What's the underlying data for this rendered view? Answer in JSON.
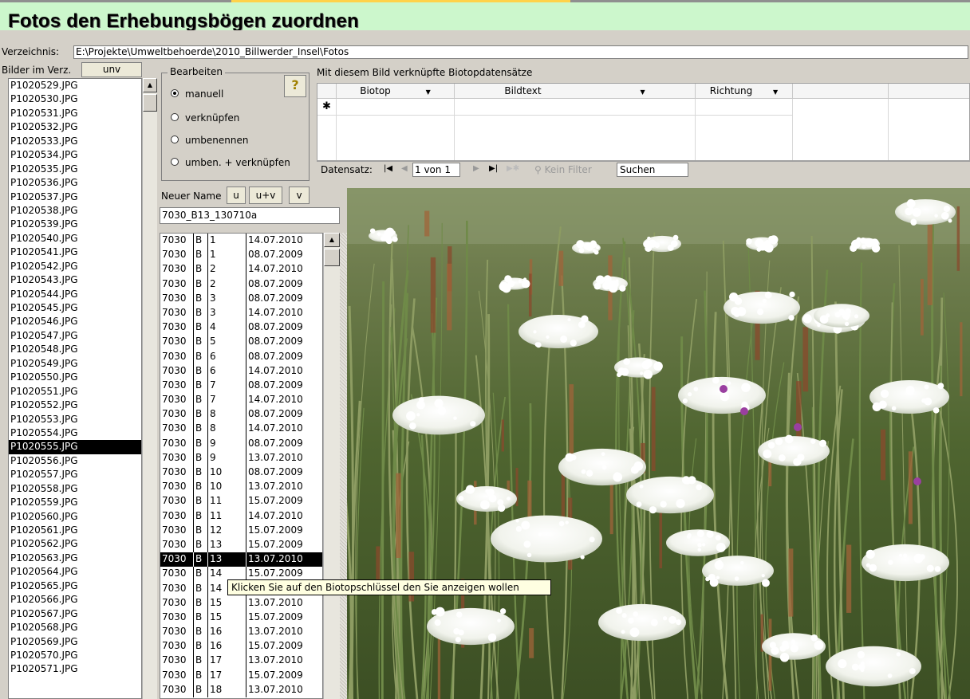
{
  "title": "Fotos den Erhebungsbögen zuordnen",
  "directory": {
    "label": "Verzeichnis:",
    "value": "E:\\Projekte\\Umweltbehoerde\\2010_Billwerder_Insel\\Fotos"
  },
  "files": {
    "label": "Bilder im Verz.",
    "unv_button": "unv",
    "items": [
      "P1020529.JPG",
      "P1020530.JPG",
      "P1020531.JPG",
      "P1020532.JPG",
      "P1020533.JPG",
      "P1020534.JPG",
      "P1020535.JPG",
      "P1020536.JPG",
      "P1020537.JPG",
      "P1020538.JPG",
      "P1020539.JPG",
      "P1020540.JPG",
      "P1020541.JPG",
      "P1020542.JPG",
      "P1020543.JPG",
      "P1020544.JPG",
      "P1020545.JPG",
      "P1020546.JPG",
      "P1020547.JPG",
      "P1020548.JPG",
      "P1020549.JPG",
      "P1020550.JPG",
      "P1020551.JPG",
      "P1020552.JPG",
      "P1020553.JPG",
      "P1020554.JPG",
      "P1020555.JPG",
      "P1020556.JPG",
      "P1020557.JPG",
      "P1020558.JPG",
      "P1020559.JPG",
      "P1020560.JPG",
      "P1020561.JPG",
      "P1020562.JPG",
      "P1020563.JPG",
      "P1020564.JPG",
      "P1020565.JPG",
      "P1020566.JPG",
      "P1020567.JPG",
      "P1020568.JPG",
      "P1020569.JPG",
      "P1020570.JPG",
      "P1020571.JPG"
    ],
    "selected": "P1020555.JPG"
  },
  "edit": {
    "title": "Bearbeiten",
    "help_button": "?",
    "options": [
      "manuell",
      "verknüpfen",
      "umbenennen",
      "umben. + verknüpfen"
    ],
    "selected_option": "manuell"
  },
  "linked": {
    "label": "Mit diesem Bild verknüpfte Biotopdatensätze",
    "columns": [
      "Biotop",
      "Bildtext",
      "Richtung"
    ],
    "new_row_marker": "✱",
    "nav": {
      "label": "Datensatz:",
      "record": "1 von 1",
      "filter": "Kein Filter",
      "search": "Suchen"
    }
  },
  "rename": {
    "label": "Neuer Name",
    "buttons": [
      "u",
      "u+v",
      "v"
    ],
    "value": "7030_B13_130710a"
  },
  "biotopes": [
    [
      "7030",
      "B",
      "1",
      "14.07.2010"
    ],
    [
      "7030",
      "B",
      "1",
      "08.07.2009"
    ],
    [
      "7030",
      "B",
      "2",
      "14.07.2010"
    ],
    [
      "7030",
      "B",
      "2",
      "08.07.2009"
    ],
    [
      "7030",
      "B",
      "3",
      "08.07.2009"
    ],
    [
      "7030",
      "B",
      "3",
      "14.07.2010"
    ],
    [
      "7030",
      "B",
      "4",
      "08.07.2009"
    ],
    [
      "7030",
      "B",
      "5",
      "08.07.2009"
    ],
    [
      "7030",
      "B",
      "6",
      "08.07.2009"
    ],
    [
      "7030",
      "B",
      "6",
      "14.07.2010"
    ],
    [
      "7030",
      "B",
      "7",
      "08.07.2009"
    ],
    [
      "7030",
      "B",
      "7",
      "14.07.2010"
    ],
    [
      "7030",
      "B",
      "8",
      "08.07.2009"
    ],
    [
      "7030",
      "B",
      "8",
      "14.07.2010"
    ],
    [
      "7030",
      "B",
      "9",
      "08.07.2009"
    ],
    [
      "7030",
      "B",
      "9",
      "13.07.2010"
    ],
    [
      "7030",
      "B",
      "10",
      "08.07.2009"
    ],
    [
      "7030",
      "B",
      "10",
      "13.07.2010"
    ],
    [
      "7030",
      "B",
      "11",
      "15.07.2009"
    ],
    [
      "7030",
      "B",
      "11",
      "14.07.2010"
    ],
    [
      "7030",
      "B",
      "12",
      "15.07.2009"
    ],
    [
      "7030",
      "B",
      "13",
      "15.07.2009"
    ],
    [
      "7030",
      "B",
      "13",
      "13.07.2010"
    ],
    [
      "7030",
      "B",
      "14",
      "15.07.2009"
    ],
    [
      "7030",
      "B",
      "14",
      ""
    ],
    [
      "7030",
      "B",
      "15",
      "13.07.2010"
    ],
    [
      "7030",
      "B",
      "15",
      "15.07.2009"
    ],
    [
      "7030",
      "B",
      "16",
      "13.07.2010"
    ],
    [
      "7030",
      "B",
      "16",
      "15.07.2009"
    ],
    [
      "7030",
      "B",
      "17",
      "13.07.2010"
    ],
    [
      "7030",
      "B",
      "17",
      "15.07.2009"
    ],
    [
      "7030",
      "B",
      "18",
      "13.07.2010"
    ]
  ],
  "biotope_selected_index": 22,
  "tooltip": "Klicken Sie auf den Biotopschlüssel den Sie anzeigen wollen",
  "colors": {
    "title_bg": "#ccf7cc",
    "accent": "#ffd24a",
    "selection": "#000000",
    "tooltip_bg": "#ffffe1",
    "window_bg": "#d4d0c8"
  }
}
